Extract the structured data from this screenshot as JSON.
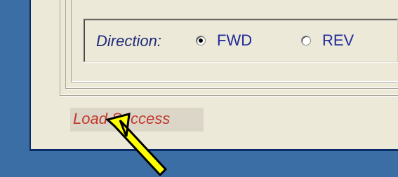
{
  "direction": {
    "label": "Direction:",
    "options": [
      {
        "label": "FWD",
        "checked": true
      },
      {
        "label": "REV",
        "checked": false
      }
    ]
  },
  "status": {
    "text": "Load Success",
    "color": "#c0392b"
  },
  "annotation": {
    "icon": "arrow-pointer-icon",
    "color": "#ffff00"
  }
}
